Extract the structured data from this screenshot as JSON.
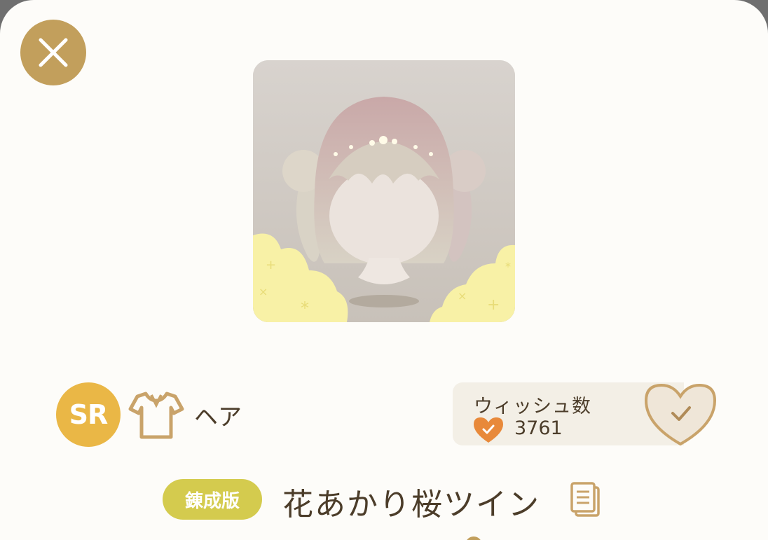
{
  "dialog": {
    "close_icon": "close-icon"
  },
  "item": {
    "preview_image": "hair-mannequin-preview",
    "rarity": "SR",
    "category_icon": "shirt-icon",
    "category": "ヘア",
    "edition": "錬成版",
    "name": "花あかり桜ツイン",
    "copy_icon": "copy-icon"
  },
  "wish": {
    "title": "ウィッシュ数",
    "count": "3761",
    "heart_icon": "heart-check-icon",
    "button_icon": "heart-check-outline-icon"
  },
  "colors": {
    "accent_gold": "#c29f5c",
    "rarity_sr": "#eab746",
    "edition_badge": "#d4cb4e",
    "wish_heart": "#e8893a",
    "text_dark": "#4c3d2a",
    "background": "#fdfcf9"
  }
}
